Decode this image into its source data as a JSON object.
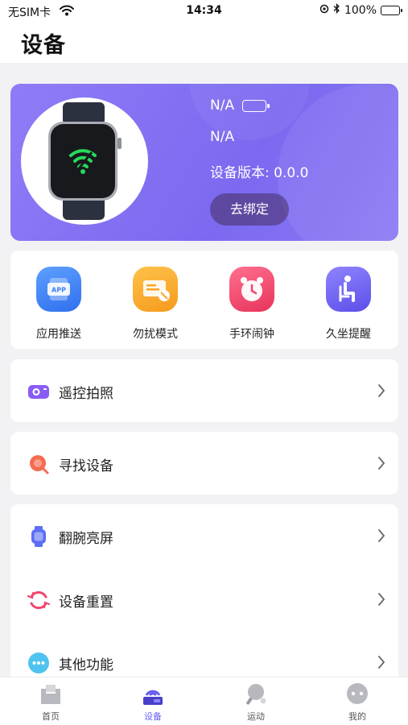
{
  "status_bar": {
    "carrier": "无SIM卡",
    "time": "14:34",
    "battery_percent": "100%"
  },
  "header": {
    "title": "设备"
  },
  "device": {
    "name": "N/A",
    "mac": "N/A",
    "version_label": "设备版本: 0.0.0",
    "unbind_label": "去绑定"
  },
  "quick_actions": [
    {
      "label": "应用推送",
      "icon": "app-push-icon",
      "color": "#3d7ef5"
    },
    {
      "label": "勿扰模式",
      "icon": "do-not-disturb-icon",
      "color": "#f7a623"
    },
    {
      "label": "手环闹钟",
      "icon": "alarm-clock-icon",
      "color": "#f0466d"
    },
    {
      "label": "久坐提醒",
      "icon": "sedentary-icon",
      "color": "#6b5cf0"
    }
  ],
  "menu": {
    "camera": {
      "label": "遥控拍照",
      "icon": "camera-icon"
    },
    "find": {
      "label": "寻找设备",
      "icon": "find-device-icon"
    },
    "wrist": {
      "label": "翻腕亮屏",
      "icon": "watch-icon"
    },
    "reset": {
      "label": "设备重置",
      "icon": "reset-icon"
    },
    "other": {
      "label": "其他功能",
      "icon": "more-icon"
    }
  },
  "tabbar": {
    "home": "首页",
    "device": "设备",
    "sport": "运动",
    "mine": "我的"
  },
  "colors": {
    "accent": "#6a5df0",
    "hero_gradient": "#8e7cf7"
  }
}
